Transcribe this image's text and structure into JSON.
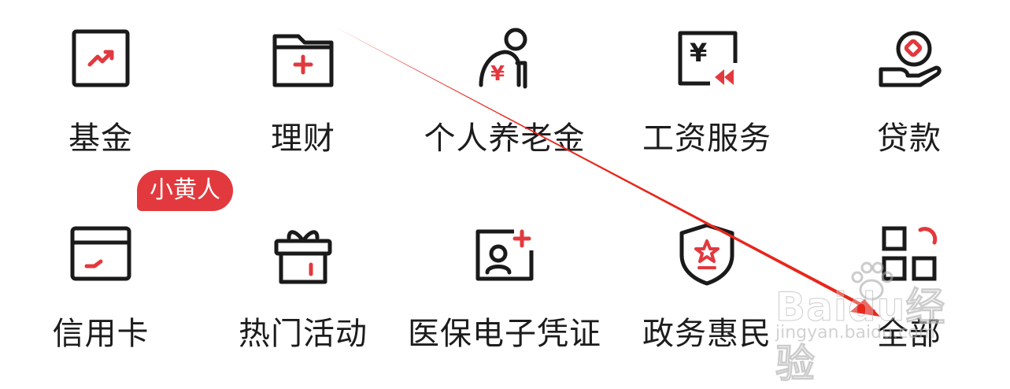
{
  "services": [
    {
      "id": "fund",
      "label": "基金",
      "icon": "fund-chart-icon"
    },
    {
      "id": "wealth",
      "label": "理财",
      "icon": "wealth-folder-icon"
    },
    {
      "id": "pension",
      "label": "个人养老金",
      "icon": "pension-elder-icon"
    },
    {
      "id": "salary",
      "label": "工资服务",
      "icon": "salary-yen-icon"
    },
    {
      "id": "loan",
      "label": "贷款",
      "icon": "loan-hand-coin-icon"
    },
    {
      "id": "credit",
      "label": "信用卡",
      "icon": "credit-card-icon"
    },
    {
      "id": "events",
      "label": "热门活动",
      "icon": "gift-box-icon"
    },
    {
      "id": "medical",
      "label": "医保电子凭证",
      "icon": "medical-id-card-icon"
    },
    {
      "id": "gov",
      "label": "政务惠民",
      "icon": "gov-shield-star-icon"
    },
    {
      "id": "all",
      "label": "全部",
      "icon": "all-apps-grid-icon"
    }
  ],
  "badge": {
    "text": "小黄人",
    "color": "#e2393e"
  },
  "annotation": {
    "arrow_color": "#e8261c"
  },
  "watermark": {
    "brand": "Baidu",
    "brand_cn": "经验",
    "url": "jingyan.baidu.com"
  },
  "colors": {
    "icon_stroke": "#1a1a1a",
    "accent": "#e2393e",
    "text": "#1c1c1c"
  }
}
